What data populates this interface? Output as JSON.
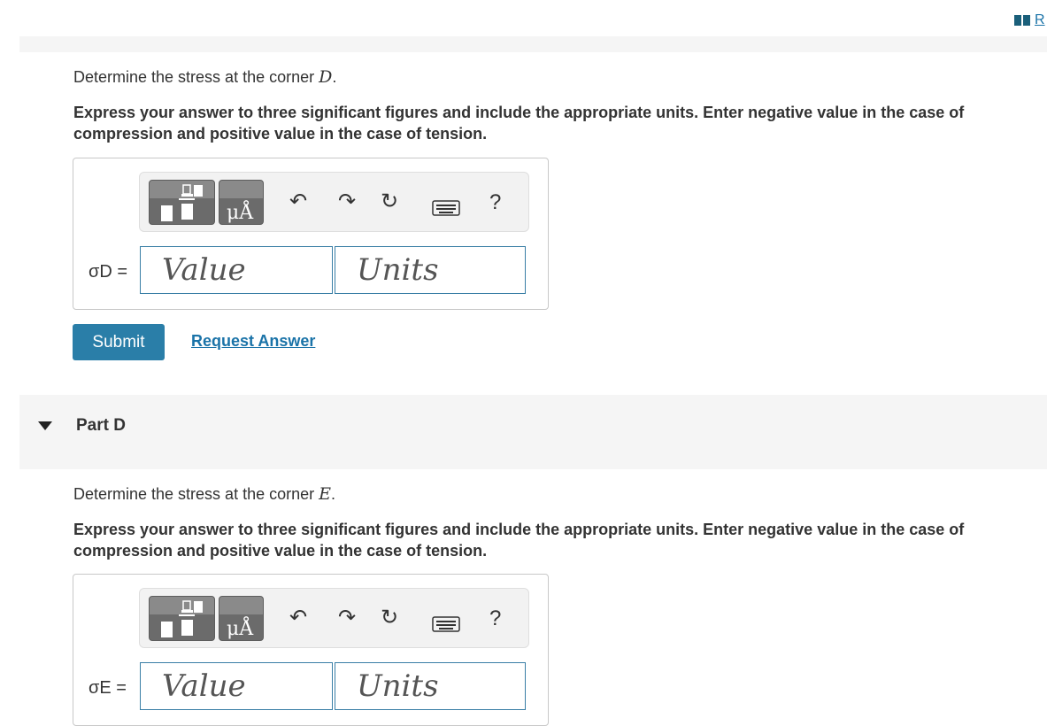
{
  "header": {
    "review_link": "R"
  },
  "partC": {
    "prompt_text": "Determine the stress at the corner ",
    "prompt_var": "D",
    "prompt_end": ".",
    "instructions": "Express your answer to three significant figures and include the appropriate units. Enter negative value in the case of compression and positive value in the case of tension.",
    "var_label": "σD =",
    "value_placeholder": "Value",
    "units_placeholder": "Units",
    "toolbar": {
      "units_symbol": "μÅ",
      "help": "?"
    },
    "submit_label": "Submit",
    "request_label": "Request Answer"
  },
  "partD": {
    "title": "Part D",
    "prompt_text": "Determine the stress at the corner ",
    "prompt_var": "E",
    "prompt_end": ".",
    "instructions": "Express your answer to three significant figures and include the appropriate units. Enter negative value in the case of compression and positive value in the case of tension.",
    "var_label": "σE =",
    "value_placeholder": "Value",
    "units_placeholder": "Units",
    "toolbar": {
      "units_symbol": "μÅ",
      "help": "?"
    }
  },
  "colors": {
    "accent": "#2a7ea8",
    "link": "#1a73a8",
    "panel": "#f5f5f5"
  }
}
